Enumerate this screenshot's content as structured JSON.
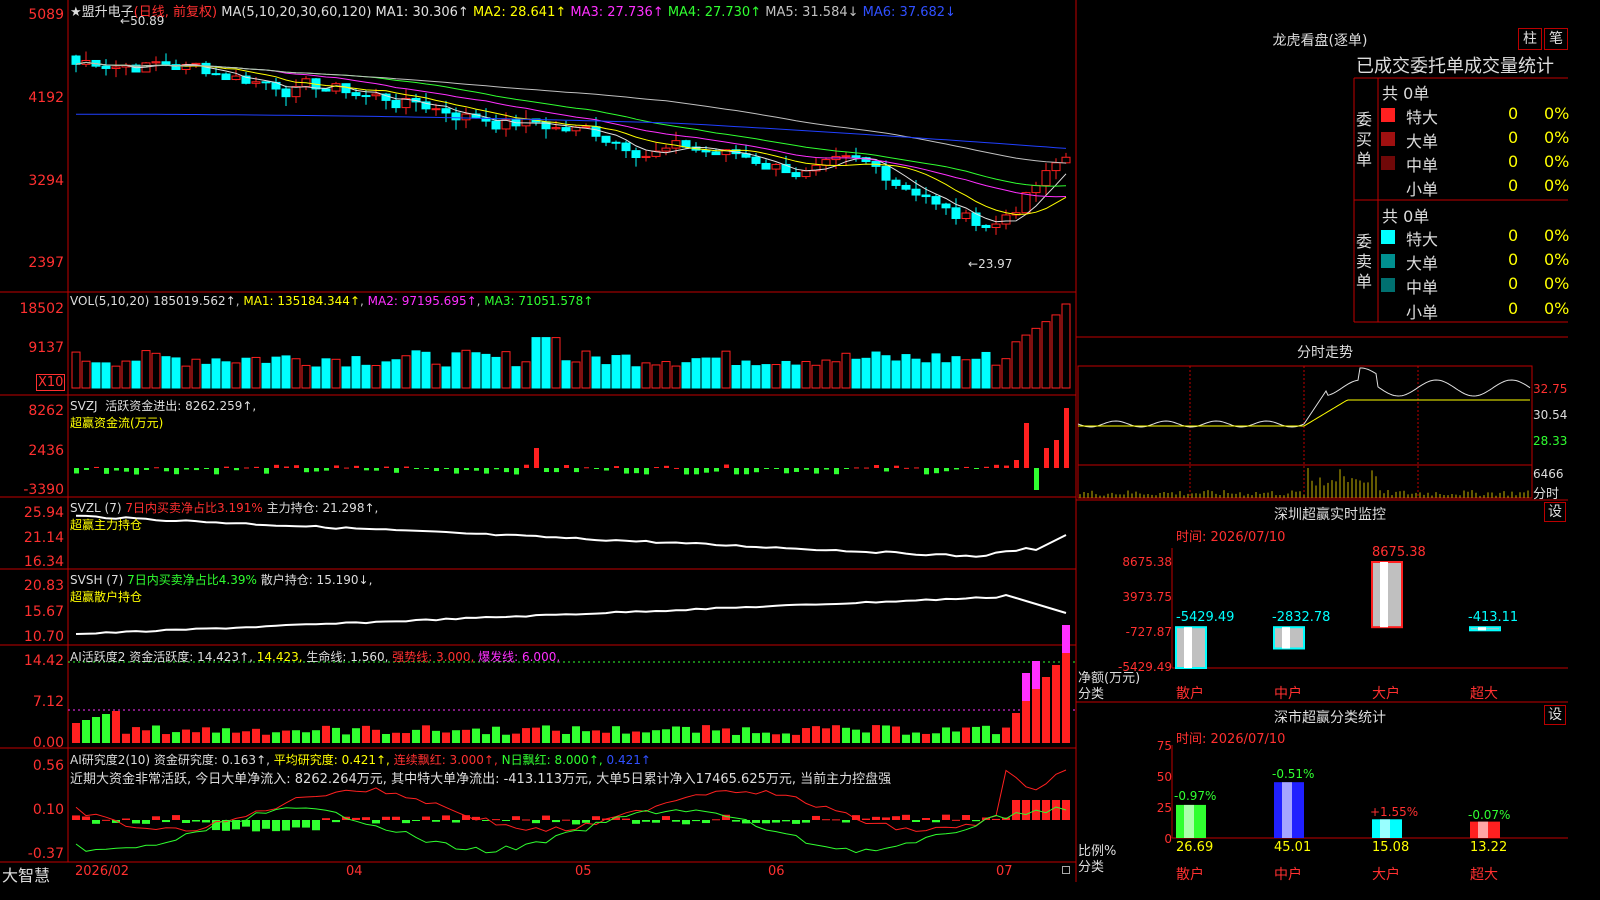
{
  "app_name": "大智慧",
  "main": {
    "star": "★",
    "name": "盟升电子",
    "mode": "(日线, 前复权)",
    "ma_title": "MA(5,10,20,30,60,120)",
    "ma": [
      {
        "text": "MA1: 30.306↑",
        "color": "#e0e0e0"
      },
      {
        "text": "MA2: 28.641↑",
        "color": "#ffff00"
      },
      {
        "text": "MA3: 27.736↑",
        "color": "#ff30ff"
      },
      {
        "text": "MA4: 27.730↑",
        "color": "#30ff30"
      },
      {
        "text": "MA5: 31.584↓",
        "color": "#c0c0c0"
      },
      {
        "text": "MA6: 37.682↓",
        "color": "#3050ff"
      }
    ],
    "high_label": "50.89",
    "low_label": "23.97",
    "y_ticks": [
      "5089",
      "4192",
      "3294",
      "2397"
    ]
  },
  "vol": {
    "title": "VOL(5,10,20)",
    "value": "185019.562↑",
    "ma1": "MA1: 135184.344↑",
    "ma2": "MA2: 97195.695↑",
    "ma3": "MA3: 71051.578↑",
    "y_ticks": [
      "18502",
      "9137"
    ],
    "unit": "X10"
  },
  "svzj": {
    "title": "SVZJ",
    "line": "活跃资金进出: 8262.259↑,",
    "sub": "超赢资金流(万元)",
    "y_ticks": [
      "8262",
      "2436",
      "-3390"
    ]
  },
  "svzl": {
    "title": "SVZL (7)",
    "ratio": "7日内买卖净占比3.191%",
    "line": "主力持仓: 21.298↑,",
    "sub": "超赢主力持仓",
    "y_ticks": [
      "25.94",
      "21.14",
      "16.34"
    ]
  },
  "svsh": {
    "title": "SVSH (7)",
    "ratio": "7日内买卖净占比4.39%",
    "line": "散户持仓: 15.190↓,",
    "sub": "超赢散户持仓",
    "y_ticks": [
      "20.83",
      "15.67",
      "10.70"
    ]
  },
  "ai1": {
    "title": "AI活跃度2",
    "a": "资金活跃度: 14.423↑,",
    "b": "14.423,",
    "c": "生命线: 1.560,",
    "d": "强势线: 3.000,",
    "e": "爆发线: 6.000,",
    "y_ticks": [
      "14.42",
      "7.12",
      "0.00"
    ]
  },
  "ai2": {
    "title": "AI研究度2(10)",
    "a": "资金研究度: 0.163↑,",
    "b": "平均研究度: 0.421↑,",
    "c": "连续飘红: 3.000↑,",
    "d": "N日飘红: 8.000↑,",
    "e": "0.421↑",
    "summary": "近期大资金非常活跃, 今日大单净流入: 8262.264万元, 其中特大单净流出: -413.113万元, 大单5日累计净入17465.625万元, 当前主力控盘强",
    "y_ticks": [
      "0.56",
      "0.10",
      "-0.37"
    ]
  },
  "x_axis": [
    "2026/02",
    "04",
    "05",
    "06",
    "07"
  ],
  "right": {
    "lhb": {
      "title": "龙虎看盘(逐单)",
      "btn_zhu": "柱",
      "btn_bi": "笔",
      "tabs": "已成交委托单成交量统计",
      "buy_label": "委买单",
      "sell_label": "委卖单",
      "buy_total": "共 0单",
      "sell_total": "共 0单",
      "buy_rows": [
        {
          "label": "特大",
          "count": "0",
          "pct": "0%",
          "color": "#ff2020"
        },
        {
          "label": "大单",
          "count": "0",
          "pct": "0%",
          "color": "#a01010"
        },
        {
          "label": "中单",
          "count": "0",
          "pct": "0%",
          "color": "#700808"
        },
        {
          "label": "小单",
          "count": "0",
          "pct": "0%",
          "color": "#000000"
        }
      ],
      "sell_rows": [
        {
          "label": "特大",
          "count": "0",
          "pct": "0%",
          "color": "#00ffff"
        },
        {
          "label": "大单",
          "count": "0",
          "pct": "0%",
          "color": "#009090"
        },
        {
          "label": "中单",
          "count": "0",
          "pct": "0%",
          "color": "#007070"
        },
        {
          "label": "小单",
          "count": "0",
          "pct": "0%",
          "color": "#000000"
        }
      ]
    },
    "fenshi": {
      "title": "分时走势",
      "y_ticks": [
        "32.75",
        "30.54",
        "28.33"
      ],
      "vol_tick": "6466",
      "vol_unit": "分时"
    },
    "monitor": {
      "title": "深圳超赢实时监控",
      "btn": "设",
      "time": "时间: 2026/07/10",
      "y_ticks": [
        "8675.38",
        "3973.75",
        "-727.87",
        "-5429.49"
      ],
      "unit1": "净额(万元)",
      "unit2": "分类",
      "categories": [
        "散户",
        "中户",
        "大户",
        "超大"
      ],
      "values": [
        -5429.49,
        -2832.78,
        8675.38,
        -413.11
      ],
      "labels": [
        "-5429.49",
        "-2832.78",
        "8675.38",
        "-413.11"
      ]
    },
    "stats": {
      "title": "深市超赢分类统计",
      "btn": "设",
      "time": "时间: 2026/07/10",
      "y_ticks": [
        "75",
        "50",
        "25",
        "0"
      ],
      "unit1": "比例%",
      "unit2": "分类",
      "categories": [
        "散户",
        "中户",
        "大户",
        "超大"
      ],
      "values": [
        26.69,
        45.01,
        15.08,
        13.22
      ],
      "changes": [
        "-0.97%",
        "-0.51%",
        "+1.55%",
        "-0.07%"
      ],
      "change_colors": [
        "#30ff30",
        "#30ff30",
        "#ff3030",
        "#30ff30"
      ]
    }
  },
  "colors": {
    "up": "#ff2020",
    "down": "#00ffff",
    "grid": "#a00000",
    "label": "#ff3030"
  }
}
